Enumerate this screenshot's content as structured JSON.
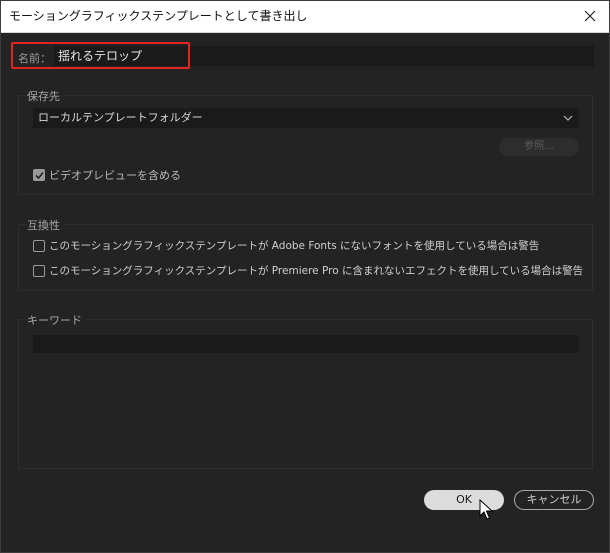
{
  "window": {
    "title": "モーショングラフィックステンプレートとして書き出し"
  },
  "name": {
    "label": "名前：",
    "value": "揺れるテロップ"
  },
  "destination": {
    "group_title": "保存先",
    "selected_option": "ローカルテンプレートフォルダー",
    "browse_label": "参照...",
    "video_preview_label": "ビデオプレビューを含める",
    "video_preview_checked": true
  },
  "compatibility": {
    "group_title": "互換性",
    "options": [
      {
        "label": "このモーショングラフィックステンプレートが Adobe Fonts にないフォントを使用している場合は警告",
        "checked": false
      },
      {
        "label": "このモーショングラフィックステンプレートが Premiere Pro に含まれないエフェクトを使用している場合は警告",
        "checked": false
      }
    ]
  },
  "keywords": {
    "group_title": "キーワード",
    "value": ""
  },
  "buttons": {
    "ok_label": "OK",
    "cancel_label": "キャンセル"
  },
  "colors": {
    "background": "#232323",
    "highlight": "#e0241f",
    "titlebar": "#ffffff"
  }
}
